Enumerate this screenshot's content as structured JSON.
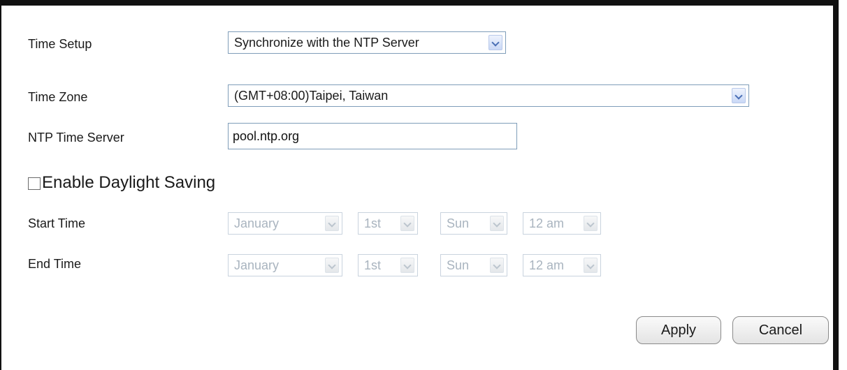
{
  "time_setup": {
    "label": "Time Setup",
    "selected": "Synchronize with the NTP Server"
  },
  "time_zone": {
    "label": "Time Zone",
    "selected": "(GMT+08:00)Taipei, Taiwan"
  },
  "ntp_server": {
    "label": "NTP Time Server",
    "value": "pool.ntp.org"
  },
  "daylight_saving": {
    "label": "Enable Daylight Saving",
    "checked": false
  },
  "start_time": {
    "label": "Start Time",
    "month": "January",
    "day": "1st",
    "weekday": "Sun",
    "hour": "12 am"
  },
  "end_time": {
    "label": "End Time",
    "month": "January",
    "day": "1st",
    "weekday": "Sun",
    "hour": "12 am"
  },
  "buttons": {
    "apply": "Apply",
    "cancel": "Cancel"
  }
}
